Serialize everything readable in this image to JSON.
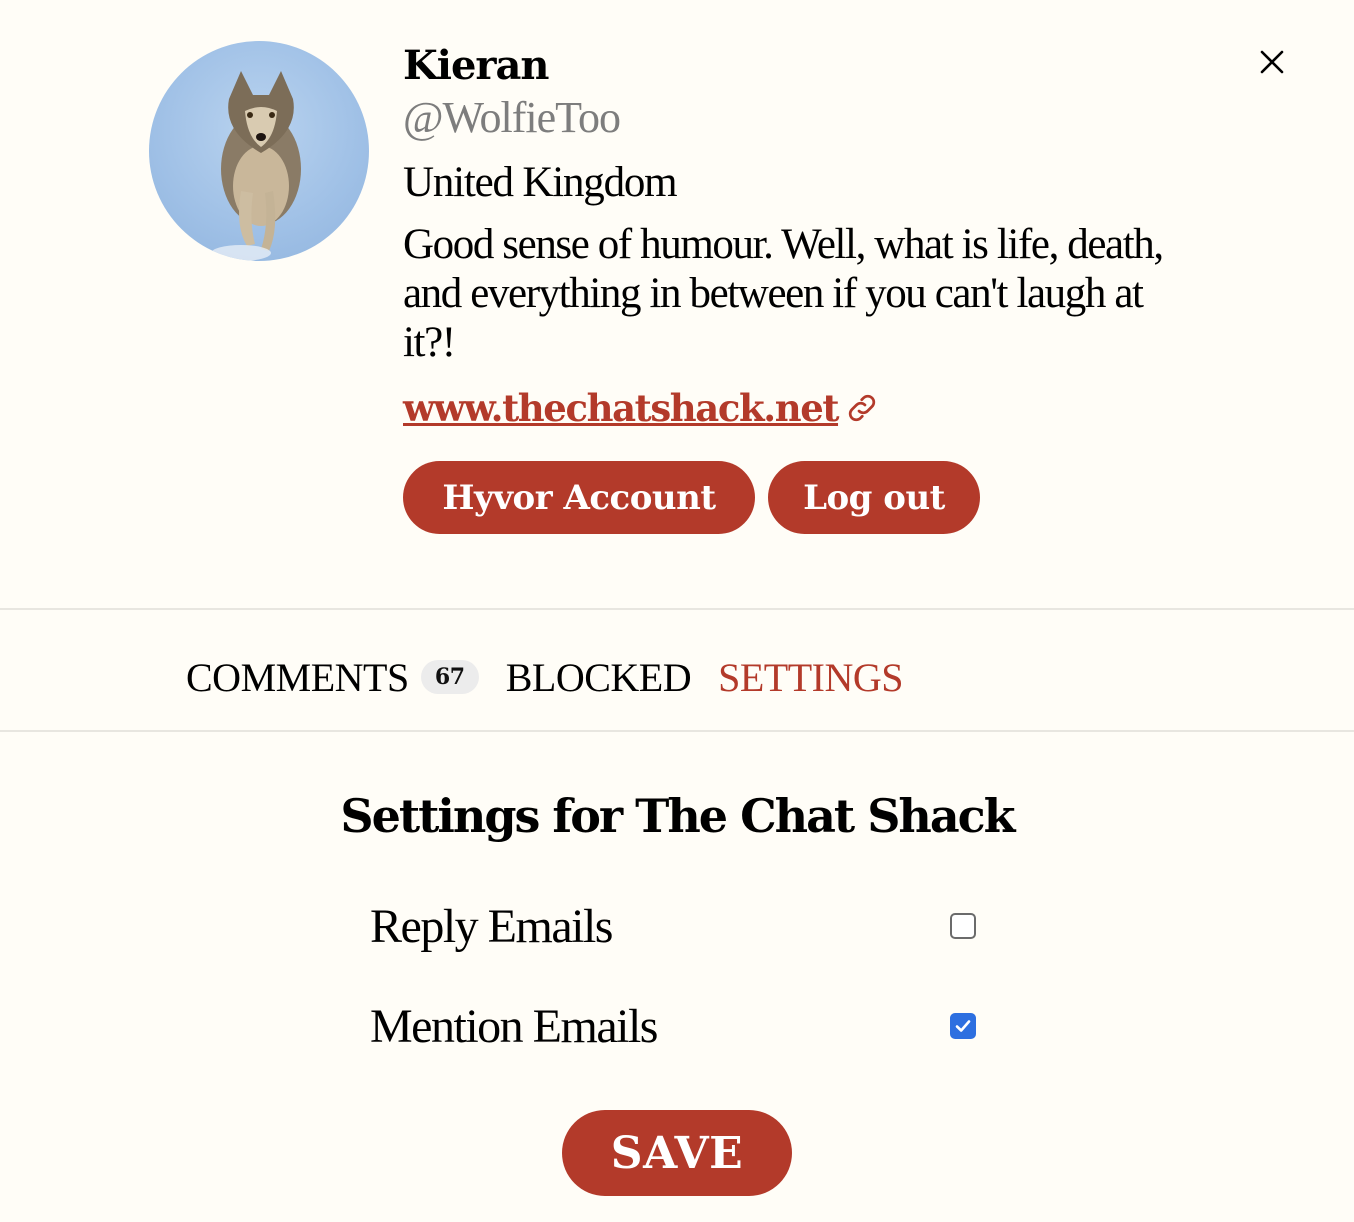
{
  "profile": {
    "name": "Kieran",
    "handle": "@WolfieToo",
    "location": "United Kingdom",
    "bio": "Good sense of humour. Well, what is life, death, and everything in between if you can't laugh at it?!",
    "website": "www.thechatshack.net",
    "avatar_icon": "wolf-avatar"
  },
  "actions": {
    "account_label": "Hyvor Account",
    "logout_label": "Log out"
  },
  "tabs": {
    "comments_label": "COMMENTS",
    "comments_count": "67",
    "blocked_label": "BLOCKED",
    "settings_label": "SETTINGS",
    "active": "SETTINGS"
  },
  "settings": {
    "title": "Settings for The Chat Shack",
    "reply_emails_label": "Reply Emails",
    "reply_emails_checked": false,
    "mention_emails_label": "Mention Emails",
    "mention_emails_checked": true,
    "save_label": "SAVE"
  },
  "colors": {
    "accent": "#b33a2a",
    "background": "#fffdf7",
    "checkbox_checked": "#2d6fe0"
  }
}
